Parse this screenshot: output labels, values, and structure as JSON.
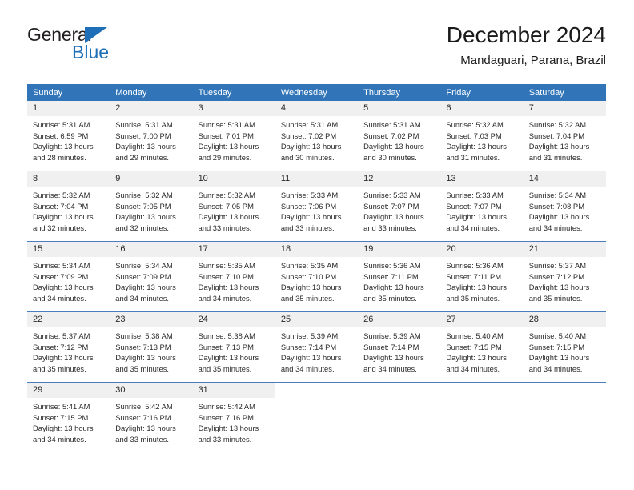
{
  "logo": {
    "word_top": "General",
    "word_bottom": "Blue",
    "triangle_icon": "triangle-icon",
    "accent_color": "#1f6fb8"
  },
  "header": {
    "title": "December 2024",
    "subtitle": "Mandaguari, Parana, Brazil"
  },
  "theme": {
    "header_blue": "#3175b8",
    "row_divider": "#4a7ebb",
    "daynum_bg": "#f0f0f0"
  },
  "calendar": {
    "weekday_headers": [
      "Sunday",
      "Monday",
      "Tuesday",
      "Wednesday",
      "Thursday",
      "Friday",
      "Saturday"
    ],
    "weeks": [
      [
        {
          "day": "1",
          "sunrise": "Sunrise: 5:31 AM",
          "sunset": "Sunset: 6:59 PM",
          "daylight_line1": "Daylight: 13 hours",
          "daylight_line2": "and 28 minutes."
        },
        {
          "day": "2",
          "sunrise": "Sunrise: 5:31 AM",
          "sunset": "Sunset: 7:00 PM",
          "daylight_line1": "Daylight: 13 hours",
          "daylight_line2": "and 29 minutes."
        },
        {
          "day": "3",
          "sunrise": "Sunrise: 5:31 AM",
          "sunset": "Sunset: 7:01 PM",
          "daylight_line1": "Daylight: 13 hours",
          "daylight_line2": "and 29 minutes."
        },
        {
          "day": "4",
          "sunrise": "Sunrise: 5:31 AM",
          "sunset": "Sunset: 7:02 PM",
          "daylight_line1": "Daylight: 13 hours",
          "daylight_line2": "and 30 minutes."
        },
        {
          "day": "5",
          "sunrise": "Sunrise: 5:31 AM",
          "sunset": "Sunset: 7:02 PM",
          "daylight_line1": "Daylight: 13 hours",
          "daylight_line2": "and 30 minutes."
        },
        {
          "day": "6",
          "sunrise": "Sunrise: 5:32 AM",
          "sunset": "Sunset: 7:03 PM",
          "daylight_line1": "Daylight: 13 hours",
          "daylight_line2": "and 31 minutes."
        },
        {
          "day": "7",
          "sunrise": "Sunrise: 5:32 AM",
          "sunset": "Sunset: 7:04 PM",
          "daylight_line1": "Daylight: 13 hours",
          "daylight_line2": "and 31 minutes."
        }
      ],
      [
        {
          "day": "8",
          "sunrise": "Sunrise: 5:32 AM",
          "sunset": "Sunset: 7:04 PM",
          "daylight_line1": "Daylight: 13 hours",
          "daylight_line2": "and 32 minutes."
        },
        {
          "day": "9",
          "sunrise": "Sunrise: 5:32 AM",
          "sunset": "Sunset: 7:05 PM",
          "daylight_line1": "Daylight: 13 hours",
          "daylight_line2": "and 32 minutes."
        },
        {
          "day": "10",
          "sunrise": "Sunrise: 5:32 AM",
          "sunset": "Sunset: 7:05 PM",
          "daylight_line1": "Daylight: 13 hours",
          "daylight_line2": "and 33 minutes."
        },
        {
          "day": "11",
          "sunrise": "Sunrise: 5:33 AM",
          "sunset": "Sunset: 7:06 PM",
          "daylight_line1": "Daylight: 13 hours",
          "daylight_line2": "and 33 minutes."
        },
        {
          "day": "12",
          "sunrise": "Sunrise: 5:33 AM",
          "sunset": "Sunset: 7:07 PM",
          "daylight_line1": "Daylight: 13 hours",
          "daylight_line2": "and 33 minutes."
        },
        {
          "day": "13",
          "sunrise": "Sunrise: 5:33 AM",
          "sunset": "Sunset: 7:07 PM",
          "daylight_line1": "Daylight: 13 hours",
          "daylight_line2": "and 34 minutes."
        },
        {
          "day": "14",
          "sunrise": "Sunrise: 5:34 AM",
          "sunset": "Sunset: 7:08 PM",
          "daylight_line1": "Daylight: 13 hours",
          "daylight_line2": "and 34 minutes."
        }
      ],
      [
        {
          "day": "15",
          "sunrise": "Sunrise: 5:34 AM",
          "sunset": "Sunset: 7:09 PM",
          "daylight_line1": "Daylight: 13 hours",
          "daylight_line2": "and 34 minutes."
        },
        {
          "day": "16",
          "sunrise": "Sunrise: 5:34 AM",
          "sunset": "Sunset: 7:09 PM",
          "daylight_line1": "Daylight: 13 hours",
          "daylight_line2": "and 34 minutes."
        },
        {
          "day": "17",
          "sunrise": "Sunrise: 5:35 AM",
          "sunset": "Sunset: 7:10 PM",
          "daylight_line1": "Daylight: 13 hours",
          "daylight_line2": "and 34 minutes."
        },
        {
          "day": "18",
          "sunrise": "Sunrise: 5:35 AM",
          "sunset": "Sunset: 7:10 PM",
          "daylight_line1": "Daylight: 13 hours",
          "daylight_line2": "and 35 minutes."
        },
        {
          "day": "19",
          "sunrise": "Sunrise: 5:36 AM",
          "sunset": "Sunset: 7:11 PM",
          "daylight_line1": "Daylight: 13 hours",
          "daylight_line2": "and 35 minutes."
        },
        {
          "day": "20",
          "sunrise": "Sunrise: 5:36 AM",
          "sunset": "Sunset: 7:11 PM",
          "daylight_line1": "Daylight: 13 hours",
          "daylight_line2": "and 35 minutes."
        },
        {
          "day": "21",
          "sunrise": "Sunrise: 5:37 AM",
          "sunset": "Sunset: 7:12 PM",
          "daylight_line1": "Daylight: 13 hours",
          "daylight_line2": "and 35 minutes."
        }
      ],
      [
        {
          "day": "22",
          "sunrise": "Sunrise: 5:37 AM",
          "sunset": "Sunset: 7:12 PM",
          "daylight_line1": "Daylight: 13 hours",
          "daylight_line2": "and 35 minutes."
        },
        {
          "day": "23",
          "sunrise": "Sunrise: 5:38 AM",
          "sunset": "Sunset: 7:13 PM",
          "daylight_line1": "Daylight: 13 hours",
          "daylight_line2": "and 35 minutes."
        },
        {
          "day": "24",
          "sunrise": "Sunrise: 5:38 AM",
          "sunset": "Sunset: 7:13 PM",
          "daylight_line1": "Daylight: 13 hours",
          "daylight_line2": "and 35 minutes."
        },
        {
          "day": "25",
          "sunrise": "Sunrise: 5:39 AM",
          "sunset": "Sunset: 7:14 PM",
          "daylight_line1": "Daylight: 13 hours",
          "daylight_line2": "and 34 minutes."
        },
        {
          "day": "26",
          "sunrise": "Sunrise: 5:39 AM",
          "sunset": "Sunset: 7:14 PM",
          "daylight_line1": "Daylight: 13 hours",
          "daylight_line2": "and 34 minutes."
        },
        {
          "day": "27",
          "sunrise": "Sunrise: 5:40 AM",
          "sunset": "Sunset: 7:15 PM",
          "daylight_line1": "Daylight: 13 hours",
          "daylight_line2": "and 34 minutes."
        },
        {
          "day": "28",
          "sunrise": "Sunrise: 5:40 AM",
          "sunset": "Sunset: 7:15 PM",
          "daylight_line1": "Daylight: 13 hours",
          "daylight_line2": "and 34 minutes."
        }
      ],
      [
        {
          "day": "29",
          "sunrise": "Sunrise: 5:41 AM",
          "sunset": "Sunset: 7:15 PM",
          "daylight_line1": "Daylight: 13 hours",
          "daylight_line2": "and 34 minutes."
        },
        {
          "day": "30",
          "sunrise": "Sunrise: 5:42 AM",
          "sunset": "Sunset: 7:16 PM",
          "daylight_line1": "Daylight: 13 hours",
          "daylight_line2": "and 33 minutes."
        },
        {
          "day": "31",
          "sunrise": "Sunrise: 5:42 AM",
          "sunset": "Sunset: 7:16 PM",
          "daylight_line1": "Daylight: 13 hours",
          "daylight_line2": "and 33 minutes."
        },
        {
          "day": "",
          "sunrise": "",
          "sunset": "",
          "daylight_line1": "",
          "daylight_line2": ""
        },
        {
          "day": "",
          "sunrise": "",
          "sunset": "",
          "daylight_line1": "",
          "daylight_line2": ""
        },
        {
          "day": "",
          "sunrise": "",
          "sunset": "",
          "daylight_line1": "",
          "daylight_line2": ""
        },
        {
          "day": "",
          "sunrise": "",
          "sunset": "",
          "daylight_line1": "",
          "daylight_line2": ""
        }
      ]
    ]
  }
}
